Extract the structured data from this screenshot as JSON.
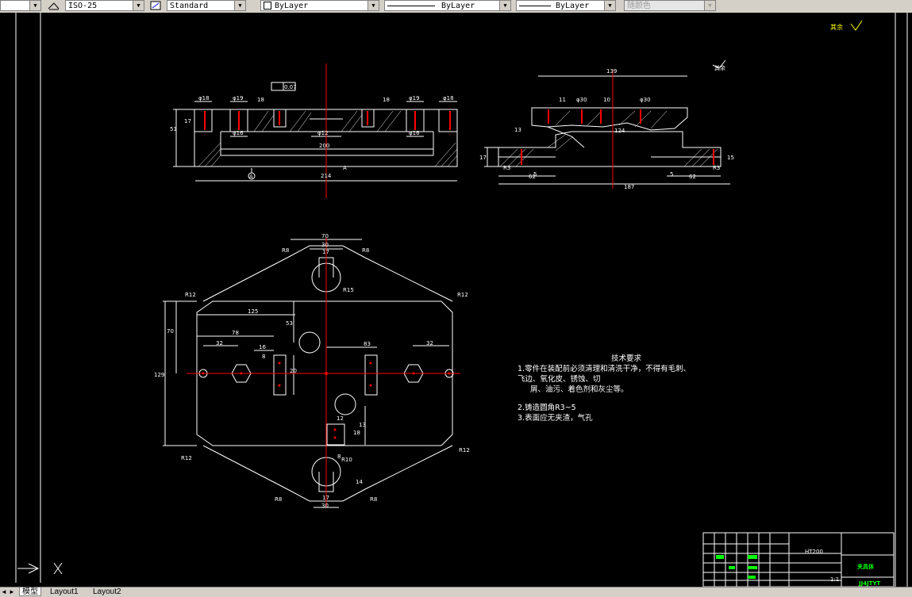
{
  "toolbar": {
    "dimstyle_value": "ISO-25",
    "textstyle_value": "Standard",
    "layer_value": "ByLayer",
    "linetype_value": "ByLayer",
    "lineweight_value": "ByLayer",
    "plotstyle_value": "随颜色"
  },
  "tabs": [
    "模型",
    "Layout1",
    "Layout2"
  ],
  "drawing": {
    "roughness_note": "其余",
    "tech_title": "技术要求",
    "tech_lines": [
      "1.零件在装配前必须清理和清洗干净，不得有毛刺、",
      "飞边、氧化皮、锈蚀、切",
      "屑、油污、着色剂和灰尘等。",
      "2.铸造圆角R3~5",
      "3.表面应无夹渣，气孔"
    ],
    "dims_front": [
      "200",
      "214",
      "φ12",
      "φ16",
      "φ16",
      "φ19",
      "φ19",
      "φ18",
      "φ18",
      "51",
      "18",
      "18",
      "17",
      "0.07",
      "A",
      "A"
    ],
    "dims_side": [
      "139",
      "187",
      "124",
      "φ30",
      "φ30",
      "62",
      "62",
      "17",
      "15",
      "13",
      "5",
      "5",
      "11",
      "10",
      "R3",
      "R3"
    ],
    "dims_plan": [
      "70",
      "30",
      "17",
      "125",
      "78",
      "32",
      "16",
      "8",
      "83",
      "32",
      "53",
      "70",
      "129",
      "R12",
      "R12",
      "R12",
      "R12",
      "R8",
      "R8",
      "R15",
      "R10",
      "R8",
      "R8",
      "30",
      "17",
      "14",
      "12",
      "18",
      "13",
      "20",
      "8"
    ],
    "title_block": {
      "material": "HT200",
      "name": "夹具体",
      "drawing_no": "JJ4JTYT",
      "scale": "1:1"
    }
  },
  "colors": {
    "background": "#000000",
    "lines": "#ffffff",
    "centerline": "#ff0000",
    "highlight": "#ffff00",
    "title_green": "#00ff00"
  }
}
